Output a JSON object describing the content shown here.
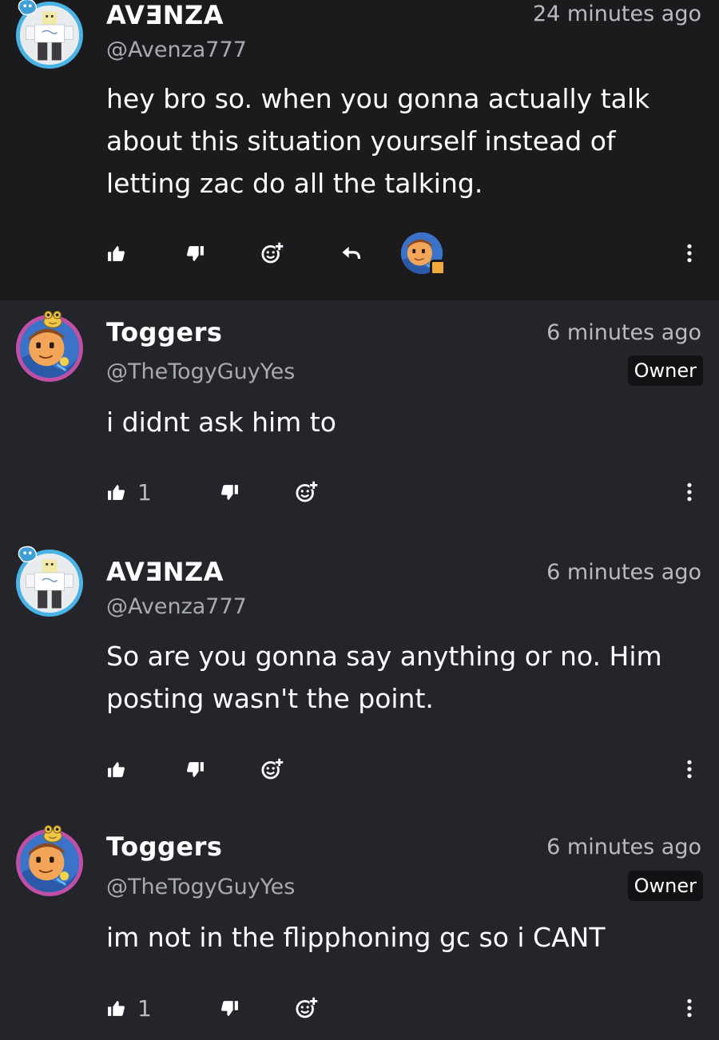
{
  "comments": [
    {
      "author": "AVƎNZA",
      "handle": "@Avenza777",
      "time": "24 minutes ago",
      "badge": "",
      "text": "hey bro so. when you gonna actually talk about this situation yourself instead of letting zac do all the talking.",
      "likes": ""
    },
    {
      "author": "Toggers",
      "handle": "@TheTogyGuyYes",
      "time": "6 minutes ago",
      "badge": "Owner",
      "text": "i didnt ask him to",
      "likes": "1"
    },
    {
      "author": "AVƎNZA",
      "handle": "@Avenza777",
      "time": "6 minutes ago",
      "badge": "",
      "text": "So are you gonna say anything or no. Him posting wasn't the point.",
      "likes": ""
    },
    {
      "author": "Toggers",
      "handle": "@TheTogyGuyYes",
      "time": "6 minutes ago",
      "badge": "Owner",
      "text": "im not in the flipphoning gc so i CANT",
      "likes": "1"
    }
  ],
  "icons": {
    "like": "thumbs-up-icon",
    "dislike": "thumbs-down-icon",
    "react": "add-reaction-icon",
    "reply": "reply-arrow-icon",
    "more": "more-vertical-icon"
  },
  "colors": {
    "background": "#23252b",
    "highlight_background": "#1b1b1d",
    "avenza_ring": "#4ab3e6",
    "toggers_ring": "#c24fa6",
    "muted_text": "#a8aaae",
    "badge_background": "#121214"
  }
}
